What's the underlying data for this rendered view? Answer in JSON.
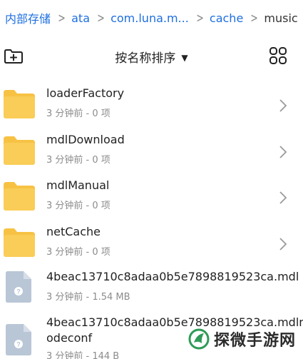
{
  "breadcrumb": {
    "items": [
      "内部存储",
      "ata",
      "com.luna.m...",
      "cache",
      "music"
    ]
  },
  "toolbar": {
    "sort_label": "按名称排序",
    "sort_caret": "▼"
  },
  "files": [
    {
      "name": "loaderFactory",
      "meta": "3 分钟前 - 0 项",
      "type": "folder"
    },
    {
      "name": "mdlDownload",
      "meta": "3 分钟前 - 0 项",
      "type": "folder"
    },
    {
      "name": "mdlManual",
      "meta": "3 分钟前 - 0 项",
      "type": "folder"
    },
    {
      "name": "netCache",
      "meta": "3 分钟前 - 0 项",
      "type": "folder"
    },
    {
      "name": "4beac13710c8adaa0b5e7898819523ca.mdl",
      "meta": "3 分钟前 - 1.54 MB",
      "type": "file"
    },
    {
      "name_line1": "4beac13710c8adaa0b5e7898819523ca.mdln",
      "name_line2": "odeconf",
      "meta": "3 分钟前 - 144 B",
      "type": "file"
    }
  ],
  "watermark": {
    "text": "探微手游网"
  },
  "colors": {
    "accent": "#1e6fe0",
    "folder": "#f7c244",
    "file_icon": "#b9c6d6"
  },
  "icons": {
    "new_folder": "new-folder-icon",
    "grid": "grid-view-icon",
    "chevron": "chevron-right-icon",
    "folder": "folder-icon",
    "file": "unknown-file-icon"
  }
}
